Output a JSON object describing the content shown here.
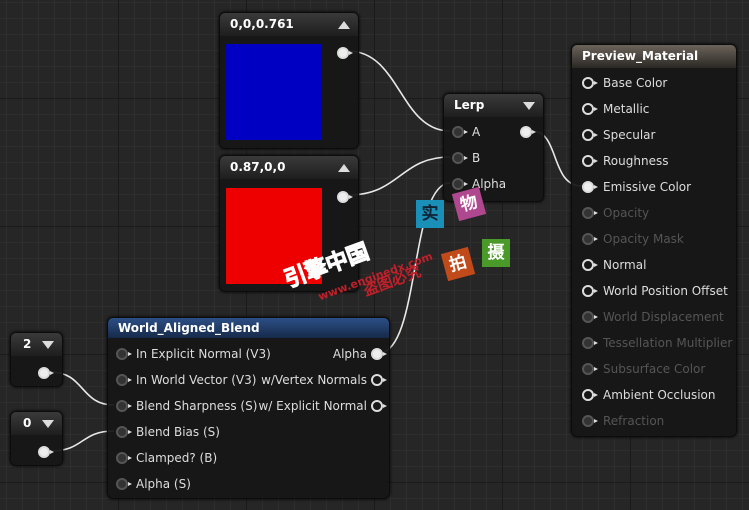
{
  "nodes": {
    "vector_blue": {
      "title": "0,0,0.761",
      "color": "#0000c2"
    },
    "vector_red": {
      "title": "0.87,0,0",
      "color": "#ee0000"
    },
    "lerp": {
      "title": "Lerp",
      "inputs": [
        "A",
        "B",
        "Alpha"
      ]
    },
    "const_2": {
      "title": "2"
    },
    "const_0": {
      "title": "0"
    },
    "world_aligned_blend": {
      "title": "World_Aligned_Blend",
      "inputs": [
        "In Explicit Normal (V3)",
        "In World Vector (V3)",
        "Blend Sharpness (S)",
        "Blend Bias (S)",
        "Clamped? (B)",
        "Alpha (S)"
      ],
      "outputs": [
        "Alpha",
        "w/Vertex Normals",
        "w/ Explicit Normal"
      ]
    },
    "preview_material": {
      "title": "Preview_Material",
      "inputs": [
        {
          "label": "Base Color",
          "enabled": true
        },
        {
          "label": "Metallic",
          "enabled": true
        },
        {
          "label": "Specular",
          "enabled": true
        },
        {
          "label": "Roughness",
          "enabled": true
        },
        {
          "label": "Emissive Color",
          "enabled": true,
          "connected": true
        },
        {
          "label": "Opacity",
          "enabled": false
        },
        {
          "label": "Opacity Mask",
          "enabled": false
        },
        {
          "label": "Normal",
          "enabled": true
        },
        {
          "label": "World Position Offset",
          "enabled": true
        },
        {
          "label": "World Displacement",
          "enabled": false
        },
        {
          "label": "Tessellation Multiplier",
          "enabled": false
        },
        {
          "label": "Subsurface Color",
          "enabled": false
        },
        {
          "label": "Ambient Occlusion",
          "enabled": true
        },
        {
          "label": "Refraction",
          "enabled": false
        }
      ]
    }
  },
  "watermark": {
    "logo": "引擎中国",
    "url": "www.enginedx.com",
    "notice": "盗图必究",
    "tiles": [
      "实",
      "物",
      "拍",
      "摄"
    ]
  }
}
